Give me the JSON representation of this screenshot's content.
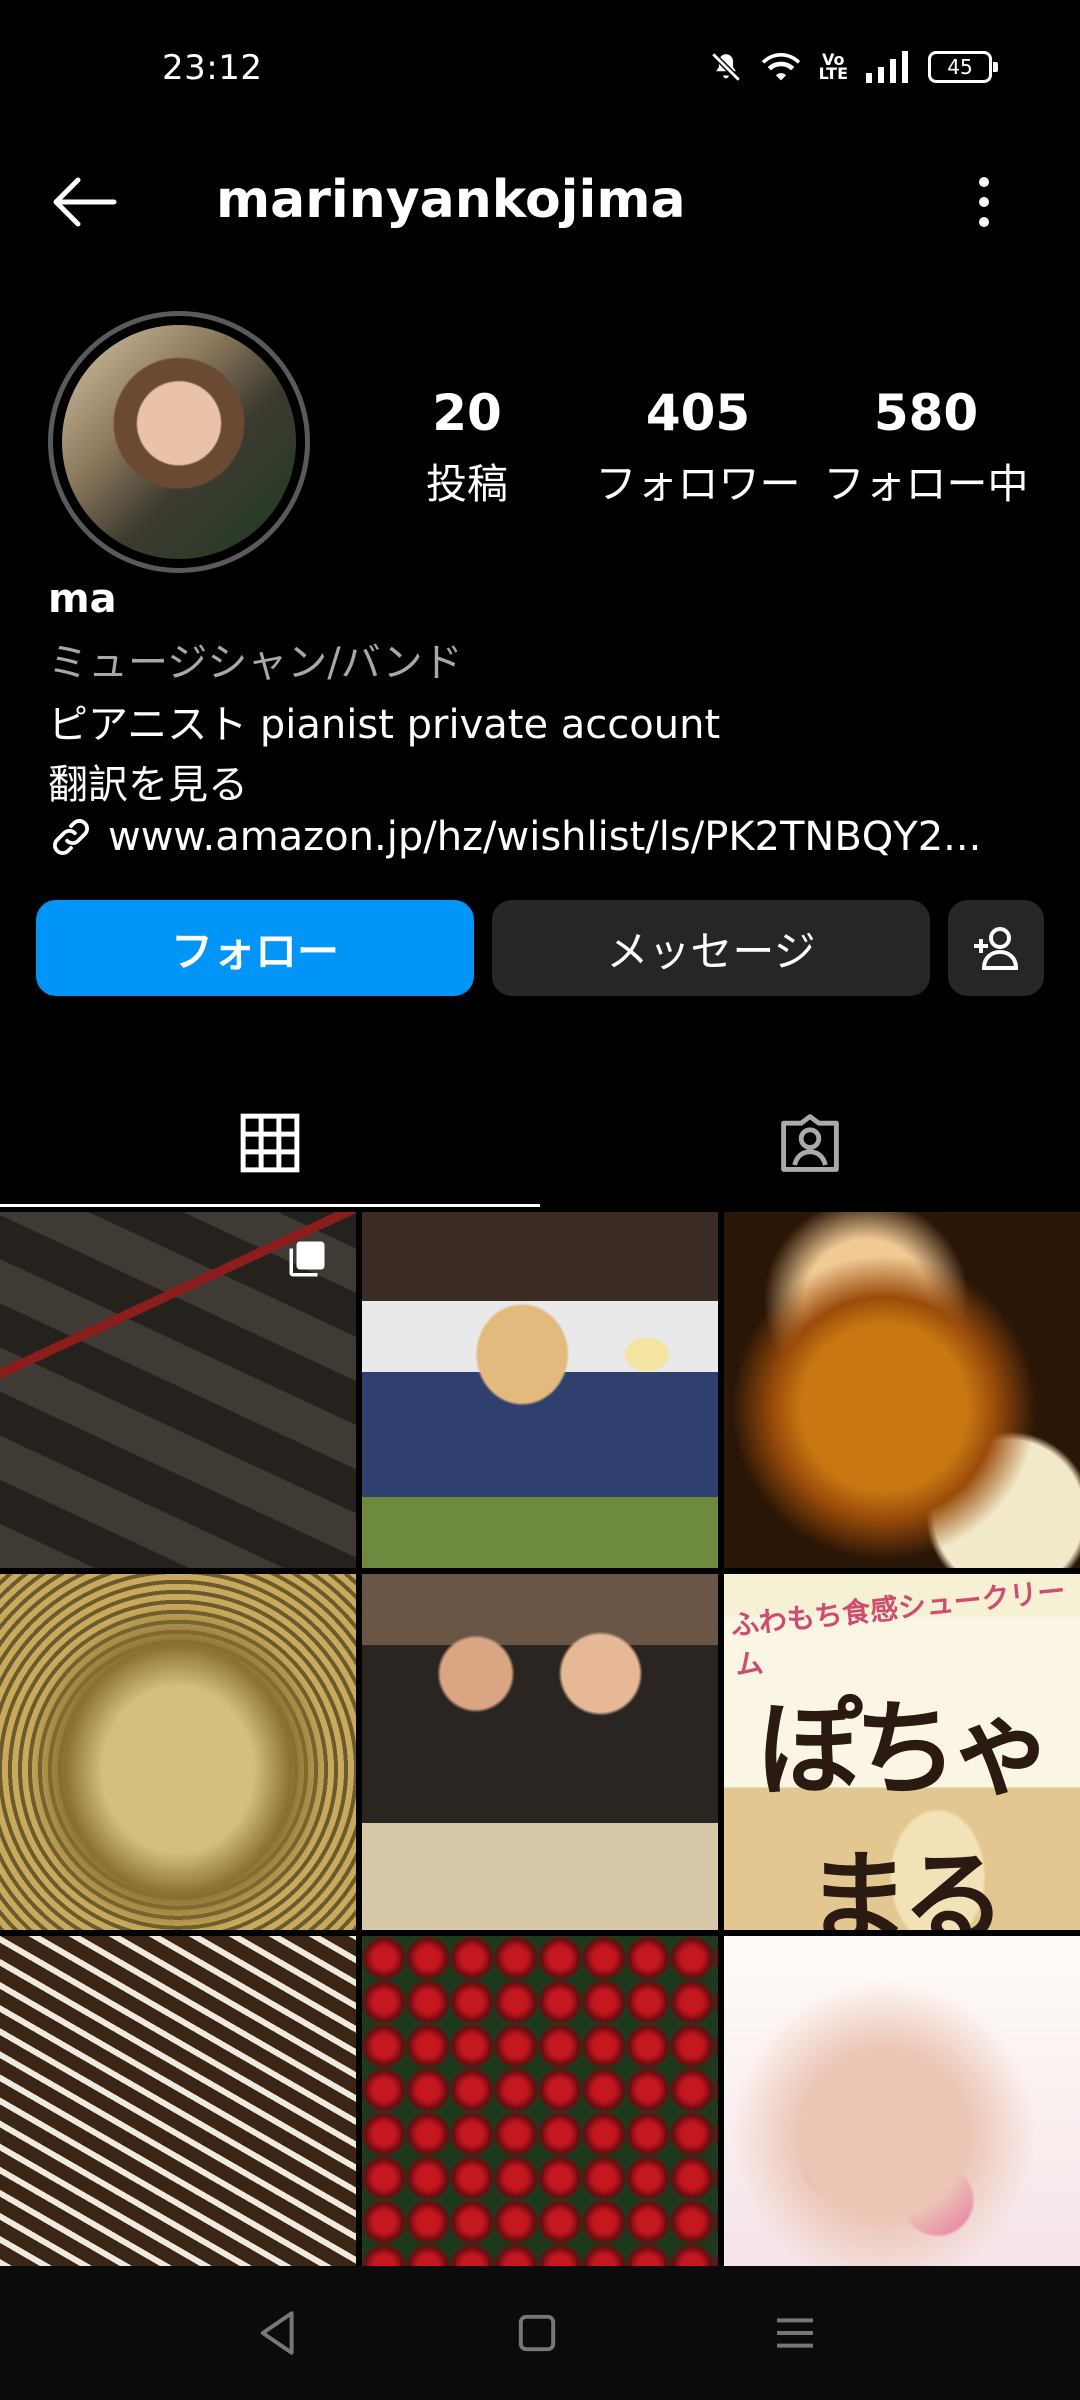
{
  "status_bar": {
    "time": "23:12",
    "battery": "45",
    "network": "VoLTE",
    "icons": [
      "mute-icon",
      "wifi-icon",
      "volte-icon",
      "signal-icon",
      "battery-icon"
    ]
  },
  "header": {
    "username": "marinyankojima",
    "back_icon": "back-arrow-icon",
    "more_icon": "more-vertical-icon"
  },
  "profile": {
    "stats": {
      "posts": {
        "value": "20",
        "label": "投稿"
      },
      "followers": {
        "value": "405",
        "label": "フォロワー"
      },
      "following": {
        "value": "580",
        "label": "フォロー中"
      }
    },
    "display_name": "ma",
    "category": "ミュージシャン/バンド",
    "bio": "ピアニスト pianist private account",
    "translate": "翻訳を見る",
    "link": "www.amazon.jp/hz/wishlist/ls/PK2TNBQY2..."
  },
  "actions": {
    "follow": "フォロー",
    "message": "メッセージ"
  },
  "tabs": [
    "grid-icon",
    "tagged-icon"
  ],
  "grid": {
    "posts": [
      {
        "subject": "mirror frames wall",
        "multi": true
      },
      {
        "subject": "girl with chihuahua and ice cream"
      },
      {
        "subject": "beer glass"
      },
      {
        "subject": "yakisoba"
      },
      {
        "subject": "two women at cafe"
      },
      {
        "subject": "cream puff package",
        "text_main": "ぽちゃまる",
        "text_top": "ふわもち食感シュークリーム"
      },
      {
        "subject": "okonomiyaki"
      },
      {
        "subject": "red roses"
      },
      {
        "subject": "pink nail art"
      }
    ]
  },
  "colors": {
    "background": "#000000",
    "follow_button": "#0095f6",
    "secondary_button": "#262626",
    "muted_text": "#a8a8a8"
  }
}
